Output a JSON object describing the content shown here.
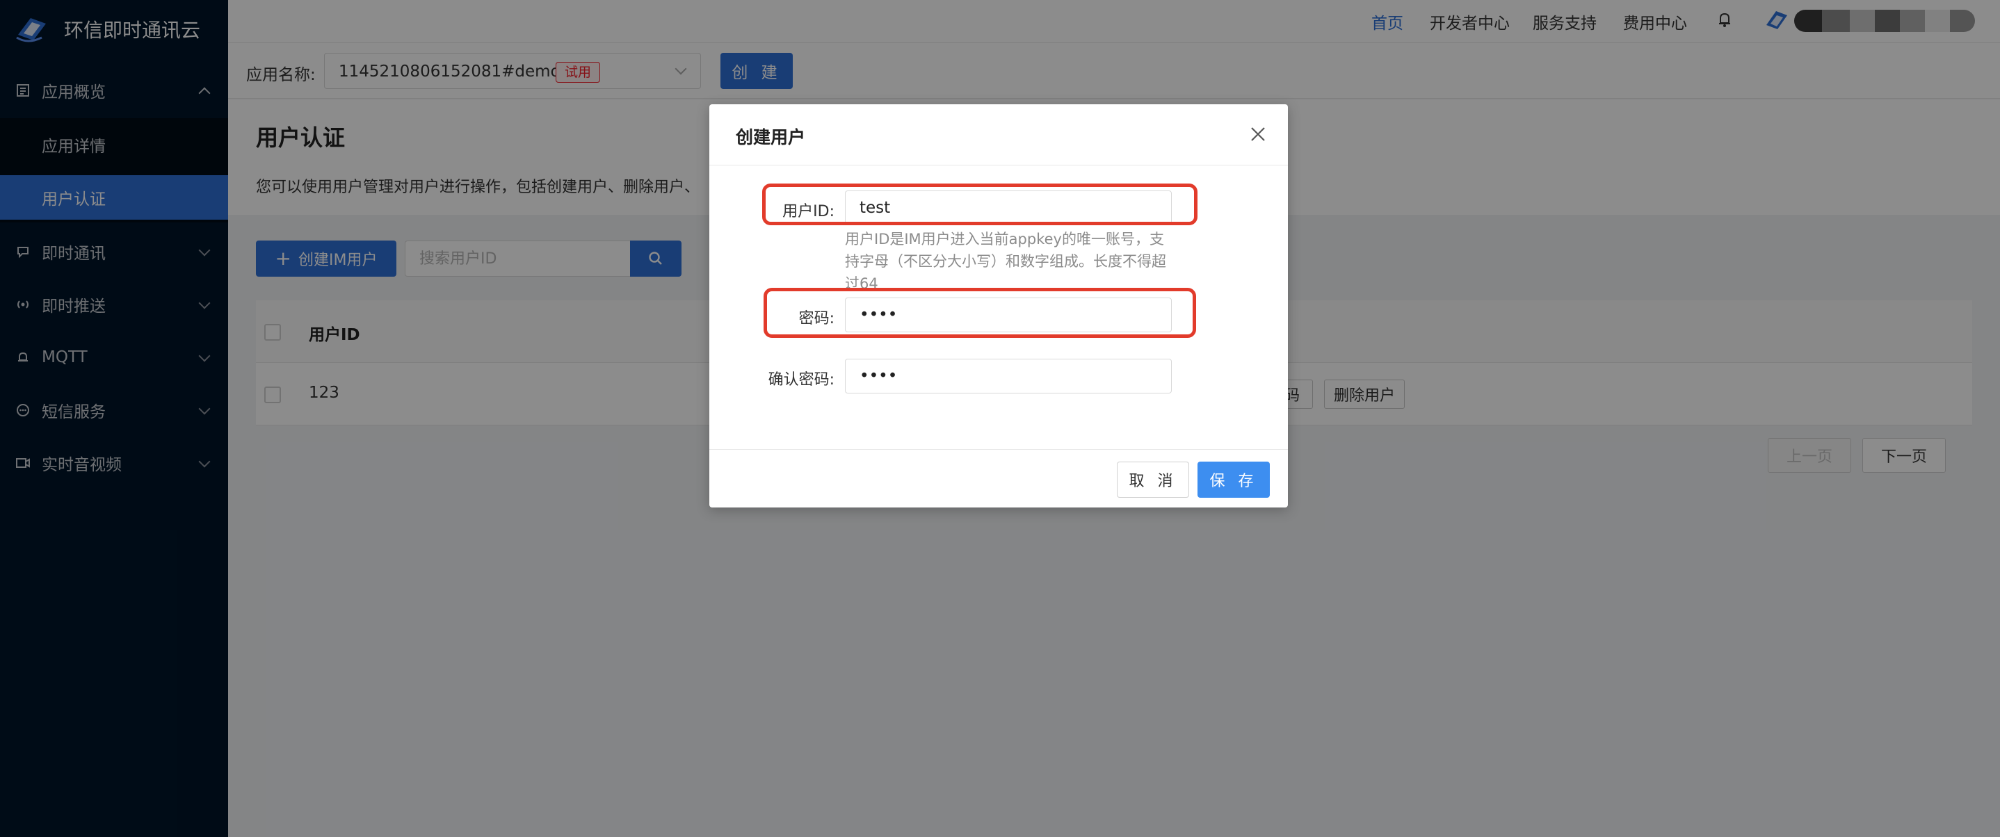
{
  "brand": {
    "name": "环信即时通讯云"
  },
  "sidebar": {
    "items": [
      {
        "label": "应用概览",
        "icon": "file-list-icon",
        "expanded": true
      },
      {
        "label": "即时通讯",
        "icon": "chat-icon"
      },
      {
        "label": "即时推送",
        "icon": "broadcast-icon"
      },
      {
        "label": "MQTT",
        "icon": "bell-icon"
      },
      {
        "label": "短信服务",
        "icon": "message-icon"
      },
      {
        "label": "实时音视频",
        "icon": "video-icon"
      }
    ],
    "sub_items": [
      {
        "label": "应用详情"
      },
      {
        "label": "用户认证",
        "active": true
      }
    ]
  },
  "topnav": {
    "links": [
      "首页",
      "开发者中心",
      "服务支持",
      "费用中心"
    ],
    "active": "首页"
  },
  "app_selector": {
    "label": "应用名称:",
    "value": "1145210806152081#demo",
    "badge": "试用",
    "create_label": "创 建"
  },
  "main": {
    "title": "用户认证",
    "description": "您可以使用用户管理对用户进行操作，包括创建用户、删除用户、",
    "create_button": "创建IM用户",
    "search_placeholder": "搜索用户ID",
    "table": {
      "columns": [
        "用户ID"
      ],
      "rows": [
        {
          "user_id": "123",
          "actions": [
            "码",
            "删除用户"
          ]
        }
      ]
    },
    "pager": {
      "prev": "上一页",
      "next": "下一页"
    }
  },
  "dialog": {
    "title": "创建用户",
    "fields": {
      "user_id": {
        "label": "用户ID:",
        "value": "test"
      },
      "user_id_help": "用户ID是IM用户进入当前appkey的唯一账号，支持字母（不区分大小写）和数字组成。长度不得超过64",
      "password": {
        "label": "密码:",
        "value": "test"
      },
      "confirm": {
        "label": "确认密码:",
        "value": "test"
      }
    },
    "cancel_label": "取 消",
    "save_label": "保 存"
  },
  "colors": {
    "sidebar_bg": "#001529",
    "primary": "#2f6fd6",
    "save_button": "#3d8ef0",
    "highlight": "#e23b2b",
    "badge_red": "#f5222d"
  }
}
